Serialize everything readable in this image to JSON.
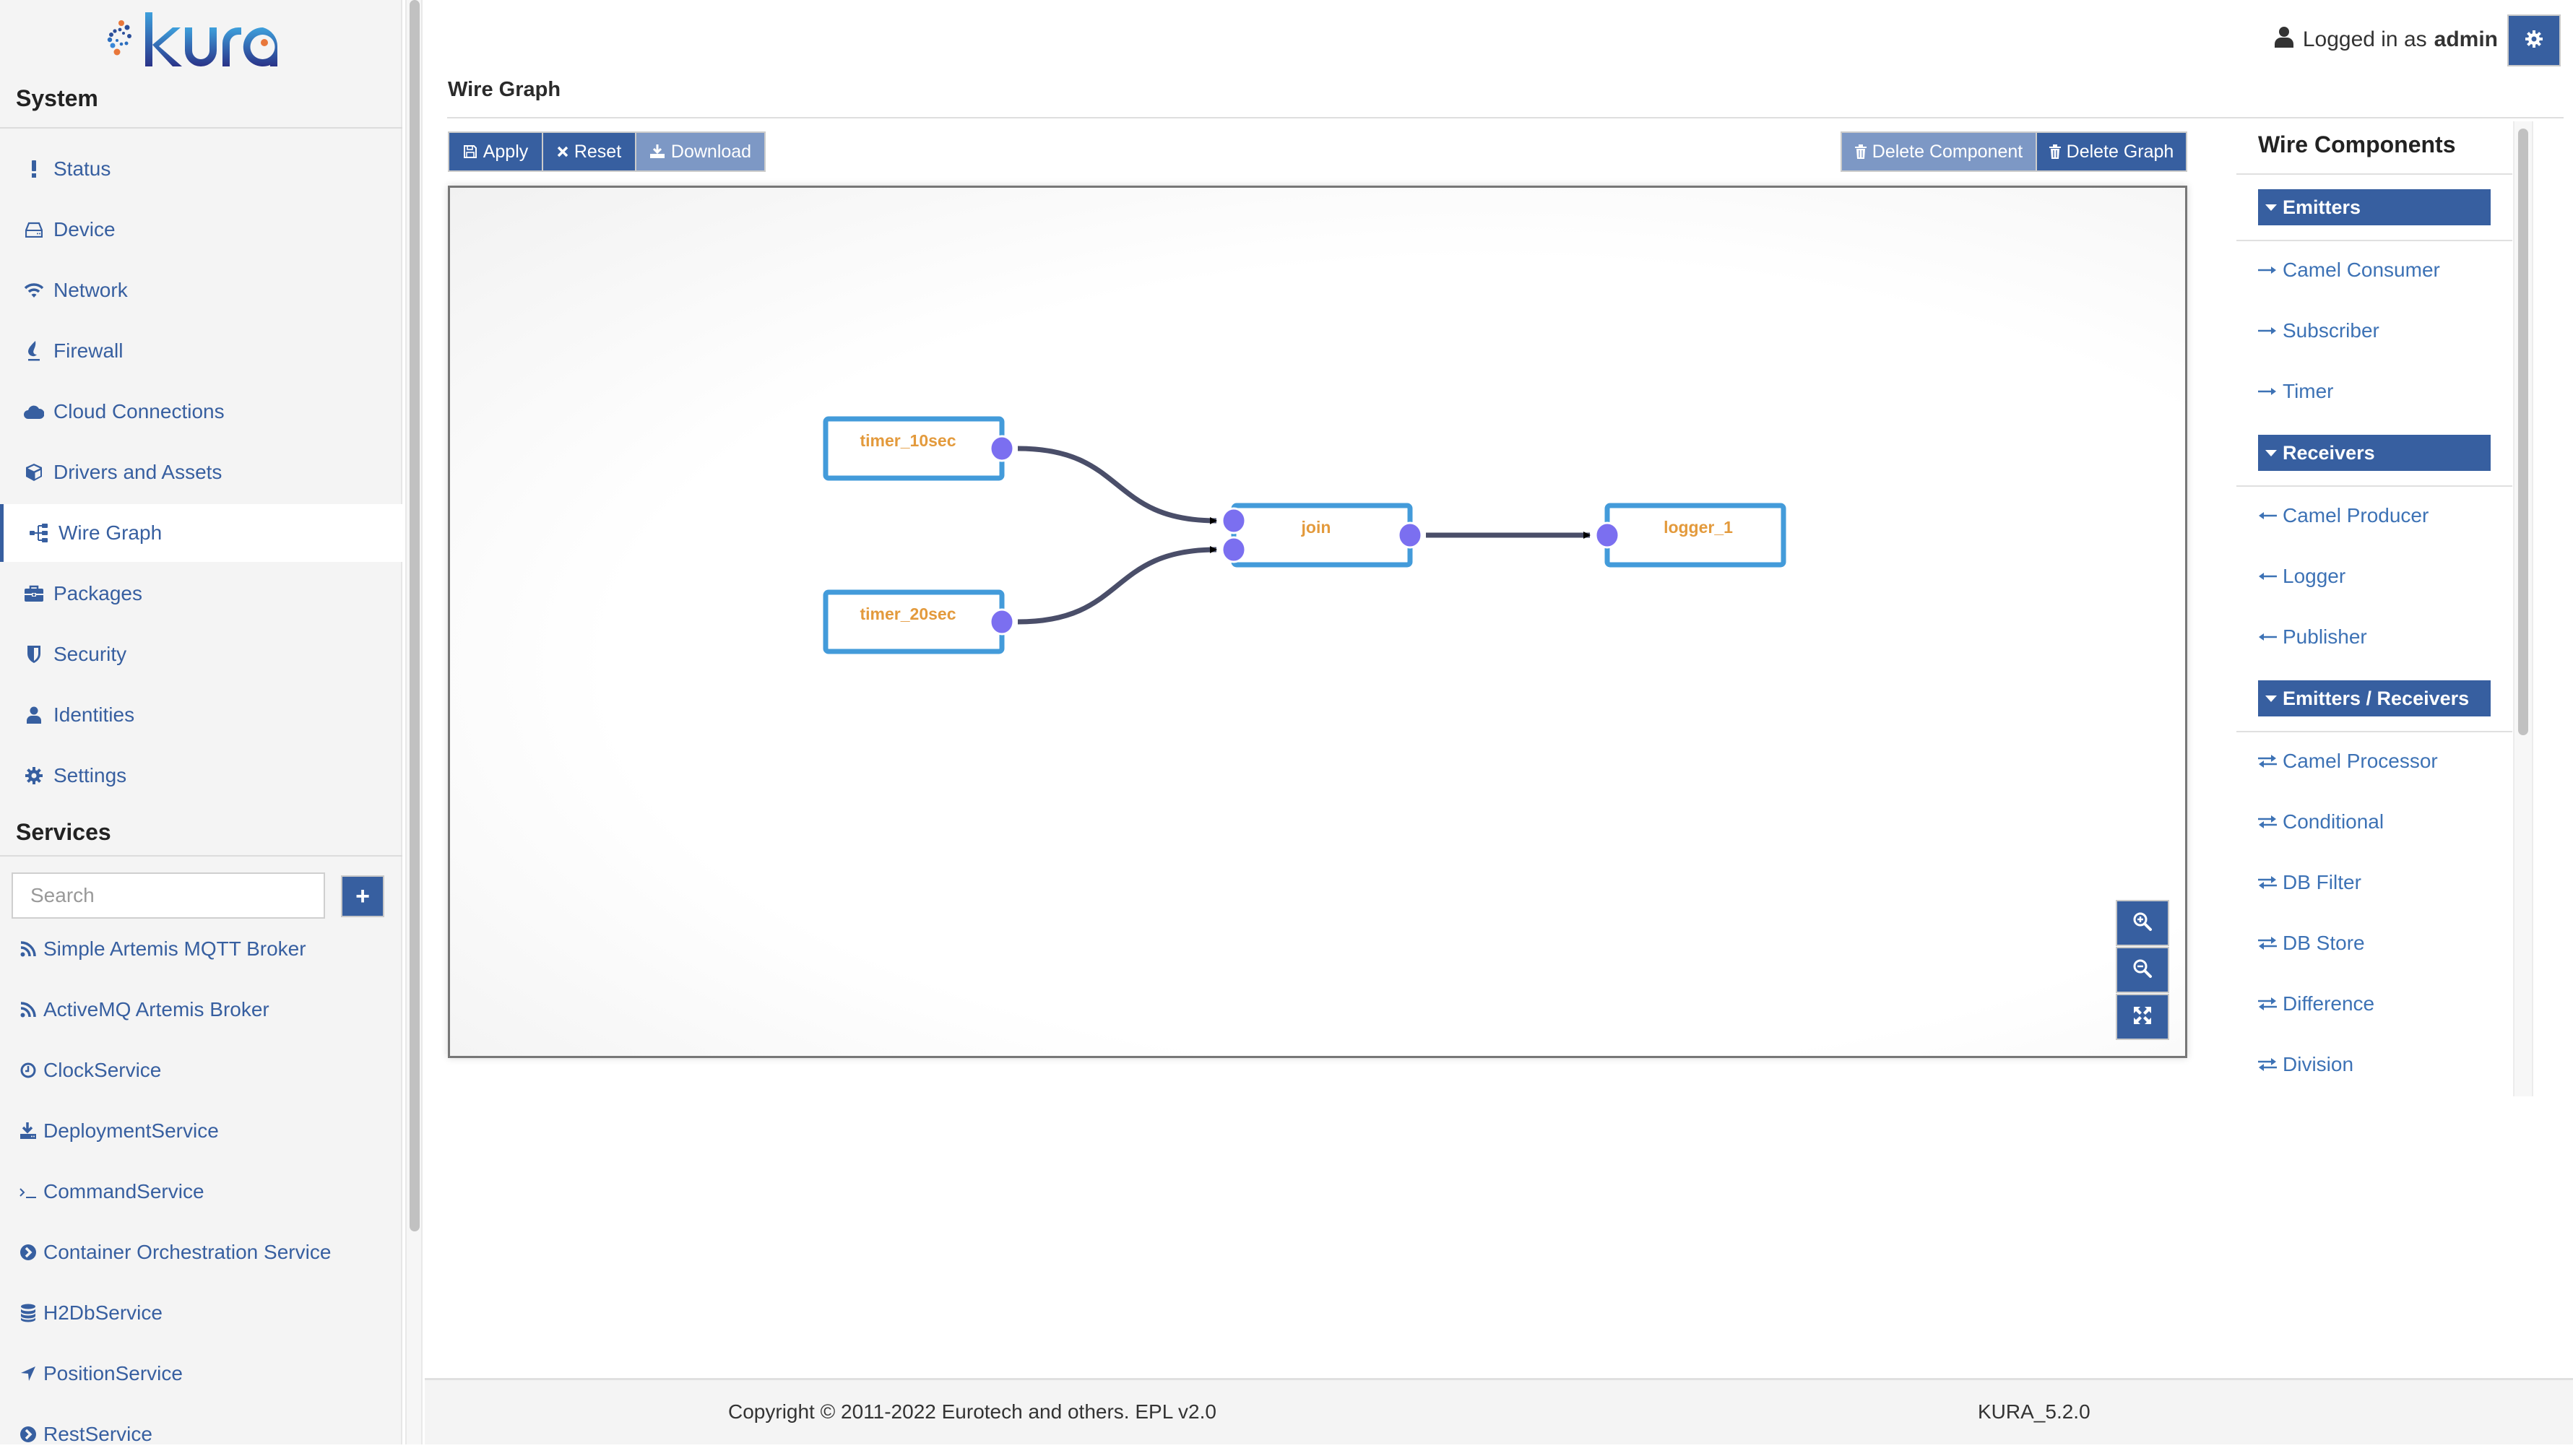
{
  "app": {
    "logo_text": "kura"
  },
  "sidebar": {
    "system_heading": "System",
    "system_items": [
      {
        "label": "Status",
        "icon": "exclamation-icon"
      },
      {
        "label": "Device",
        "icon": "hdd-icon"
      },
      {
        "label": "Network",
        "icon": "wifi-icon"
      },
      {
        "label": "Firewall",
        "icon": "fire-icon"
      },
      {
        "label": "Cloud Connections",
        "icon": "cloud-icon"
      },
      {
        "label": "Drivers and Assets",
        "icon": "cube-icon"
      },
      {
        "label": "Wire Graph",
        "icon": "sitemap-icon",
        "active": true
      },
      {
        "label": "Packages",
        "icon": "briefcase-icon"
      },
      {
        "label": "Security",
        "icon": "shield-icon"
      },
      {
        "label": "Identities",
        "icon": "user-icon"
      },
      {
        "label": "Settings",
        "icon": "gear-icon"
      }
    ],
    "services_heading": "Services",
    "search_placeholder": "Search",
    "add_label": "+",
    "services": [
      {
        "label": "Simple Artemis MQTT Broker",
        "icon": "rss-icon"
      },
      {
        "label": "ActiveMQ Artemis Broker",
        "icon": "rss-icon"
      },
      {
        "label": "ClockService",
        "icon": "clock-icon"
      },
      {
        "label": "DeploymentService",
        "icon": "download-icon"
      },
      {
        "label": "CommandService",
        "icon": "terminal-icon"
      },
      {
        "label": "Container Orchestration Service",
        "icon": "chevron-circle-right-icon"
      },
      {
        "label": "H2DbService",
        "icon": "database-icon"
      },
      {
        "label": "PositionService",
        "icon": "location-arrow-icon"
      },
      {
        "label": "RestService",
        "icon": "chevron-circle-right-icon"
      }
    ]
  },
  "header": {
    "logged_in_prefix": "Logged in as",
    "username": "admin"
  },
  "main": {
    "title": "Wire Graph",
    "toolbar": {
      "apply": "Apply",
      "reset": "Reset",
      "download": "Download",
      "delete_component": "Delete Component",
      "delete_graph": "Delete Graph"
    },
    "graph": {
      "nodes": [
        {
          "id": "timer_10sec",
          "label": "timer_10sec",
          "inputs": 0,
          "outputs": 1
        },
        {
          "id": "timer_20sec",
          "label": "timer_20sec",
          "inputs": 0,
          "outputs": 1
        },
        {
          "id": "join",
          "label": "join",
          "inputs": 2,
          "outputs": 1
        },
        {
          "id": "logger_1",
          "label": "logger_1",
          "inputs": 1,
          "outputs": 0
        }
      ],
      "wires": [
        {
          "from": "timer_10sec",
          "to": "join",
          "to_port": 0
        },
        {
          "from": "timer_20sec",
          "to": "join",
          "to_port": 1
        },
        {
          "from": "join",
          "to": "logger_1",
          "to_port": 0
        }
      ],
      "colors": {
        "node_border": "#439bda",
        "node_label": "#e39a3c",
        "port": "#7b6ff0",
        "wire": "#4a4e69",
        "arrow": "#000000"
      }
    },
    "zoom_controls": [
      "zoom-in",
      "zoom-out",
      "fit"
    ]
  },
  "wire_components": {
    "title": "Wire Components",
    "categories": [
      {
        "label": "Emitters",
        "direction": "emitter",
        "items": [
          "Camel Consumer",
          "Subscriber",
          "Timer"
        ]
      },
      {
        "label": "Receivers",
        "direction": "receiver",
        "items": [
          "Camel Producer",
          "Logger",
          "Publisher"
        ]
      },
      {
        "label": "Emitters / Receivers",
        "direction": "both",
        "items": [
          "Camel Processor",
          "Conditional",
          "DB Filter",
          "DB Store",
          "Difference",
          "Division"
        ]
      }
    ]
  },
  "footer": {
    "copyright": "Copyright © 2011-2022 Eurotech and others. EPL v2.0",
    "version": "KURA_5.2.0"
  },
  "theme": {
    "primary": "#375fa0",
    "primary_disabled": "#7d98c5",
    "link": "#3d72b5"
  }
}
